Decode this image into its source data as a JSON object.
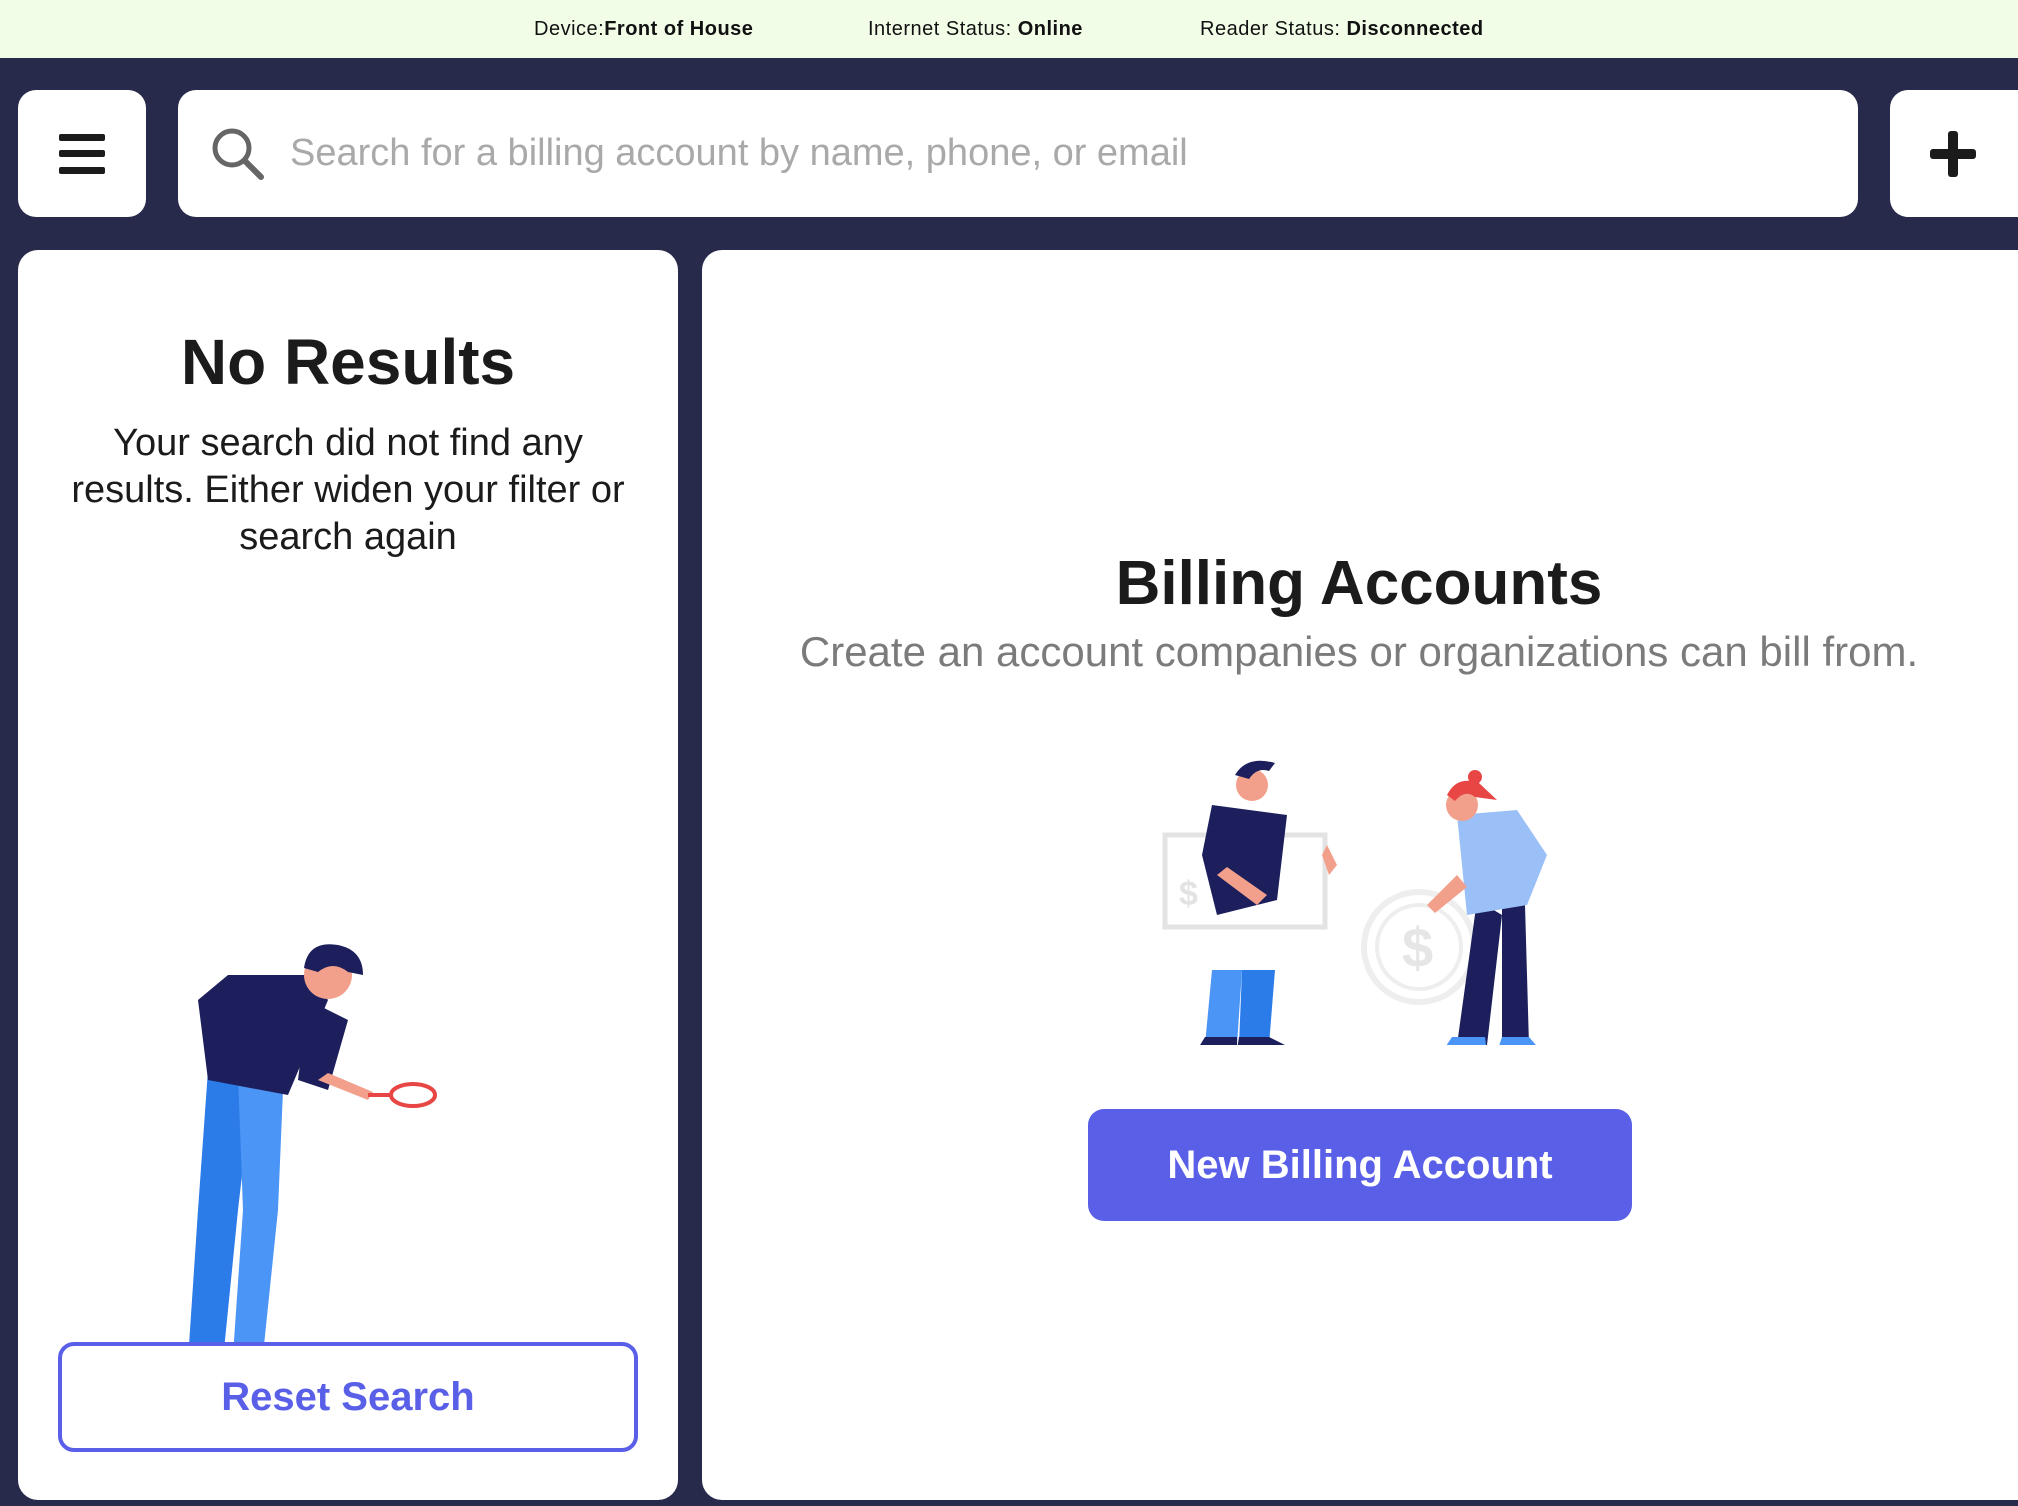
{
  "status_bar": {
    "device_label": "Device:",
    "device_value": "Front of House",
    "internet_label": "Internet Status: ",
    "internet_value": "Online",
    "reader_label": "Reader Status: ",
    "reader_value": "Disconnected"
  },
  "search": {
    "placeholder": "Search for a billing account by name, phone, or email",
    "value": ""
  },
  "left_panel": {
    "title": "No Results",
    "message": "Your search did not find any results. Either widen your filter or search again",
    "reset_button": "Reset Search"
  },
  "right_panel": {
    "title": "Billing Accounts",
    "subtitle": "Create an account companies or organizations can bill from.",
    "new_button": "New Billing Account"
  },
  "colors": {
    "accent": "#5a5fe8",
    "background": "#272a4a",
    "status_bar": "#f2fde8"
  },
  "icons": [
    "menu-icon",
    "search-icon",
    "plus-icon"
  ]
}
